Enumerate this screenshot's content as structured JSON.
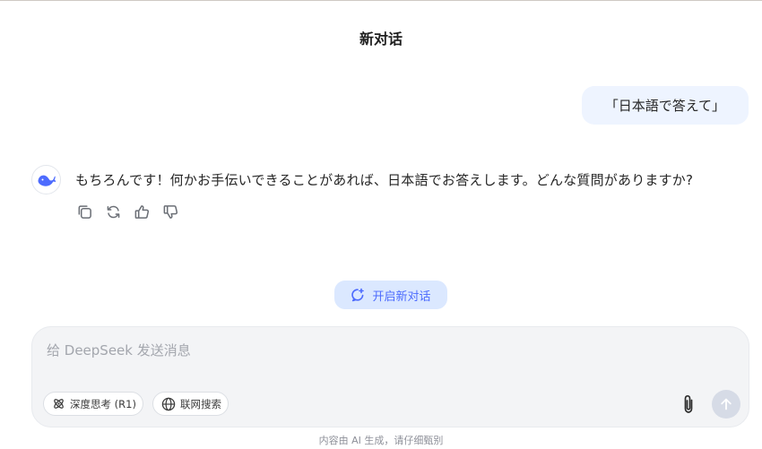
{
  "header": {
    "title": "新对话"
  },
  "conversation": {
    "user_message": "「日本語で答えて」",
    "assistant_message": "もちろんです！何かお手伝いできることがあれば、日本語でお答えします。どんな質問がありますか?",
    "assistant_avatar_icon": "deepseek-whale-icon",
    "actions": [
      {
        "icon": "copy-icon"
      },
      {
        "icon": "regenerate-icon"
      },
      {
        "icon": "thumbs-up-icon"
      },
      {
        "icon": "thumbs-down-icon"
      }
    ]
  },
  "new_chat": {
    "label": "开启新对话",
    "icon": "new-chat-icon"
  },
  "composer": {
    "placeholder": "给 DeepSeek 发送消息",
    "value": "",
    "deep_think_label": "深度思考 (R1)",
    "web_search_label": "联网搜索",
    "attach_icon": "paperclip-icon",
    "send_icon": "arrow-up-icon"
  },
  "footer": {
    "disclaimer": "内容由 AI 生成，请仔细甄别"
  },
  "colors": {
    "accent": "#4d6bfe",
    "user_bubble": "#eef4ff",
    "new_chat_bg": "#dbe8ff",
    "composer_bg": "#f3f4f6",
    "send_disabled": "#d6dbe6"
  }
}
